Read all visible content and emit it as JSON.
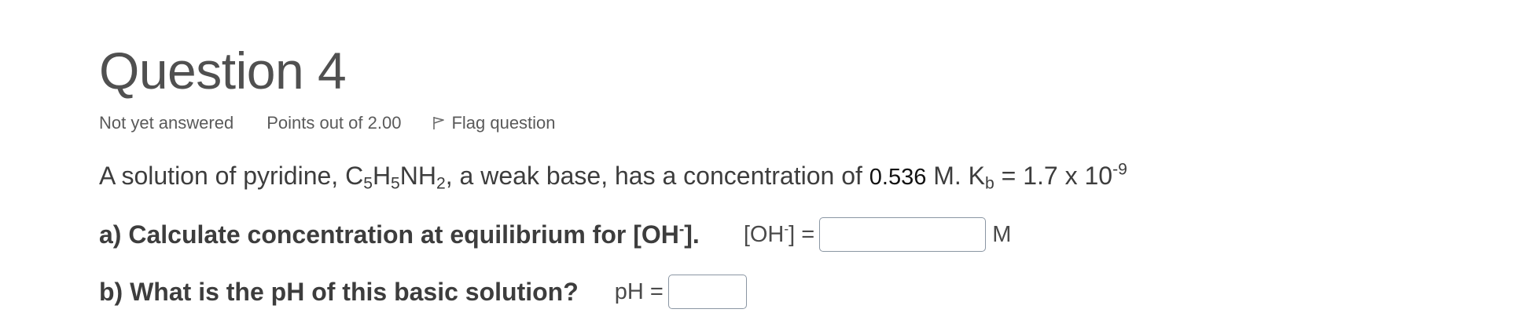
{
  "question": {
    "title": "Question 4",
    "status": "Not yet answered",
    "points": "Points out of 2.00",
    "flag_label": "Flag question",
    "flag_icon": "flag-icon"
  },
  "text": {
    "intro": "A solution of pyridine, C",
    "sub5a": "5",
    "h": "H",
    "sub5b": "5",
    "nh": "NH",
    "sub2": "2",
    "mid": ", a weak base, has a concentration of ",
    "concentration": "0.536",
    "m_kb": " M. K",
    "sub_b": "b",
    "kb_eq": " = 1.7 x 10",
    "exp": "-9"
  },
  "part_a": {
    "question_pre": "a) Calculate concentration at equilibrium for [OH",
    "question_sup": "-",
    "question_post": "].",
    "label_pre": "[OH",
    "label_sup": "-",
    "label_post": "] =",
    "value": "",
    "unit": "M"
  },
  "part_b": {
    "question": "b) What is the pH of this basic solution?",
    "label": "pH =",
    "value": ""
  }
}
